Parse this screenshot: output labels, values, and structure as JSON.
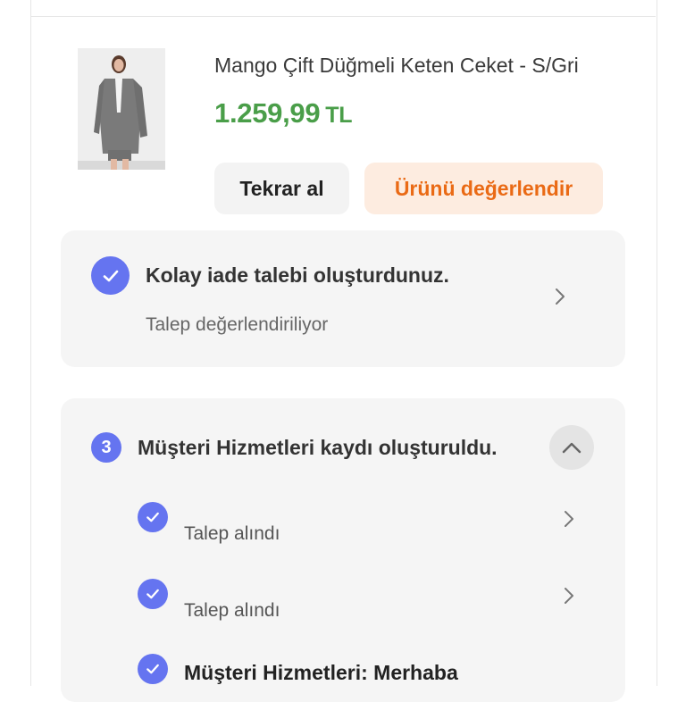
{
  "product": {
    "name": "Mango Çift Düğmeli Keten Ceket - S/Gri",
    "price": "1.259,99",
    "currency": "TL",
    "image_alt": "product-photo",
    "price_color": "#4a9e49",
    "buttons": {
      "rebuy": "Tekrar al",
      "review": "Ürünü değerlendir"
    }
  },
  "return_request": {
    "title": "Kolay iade talebi oluşturdunuz.",
    "status": "Talep değerlendiriliyor",
    "icon": "check-circle-icon"
  },
  "customer_service": {
    "step_number": "3",
    "title": "Müşteri Hizmetleri kaydı oluşturuldu.",
    "expanded": true,
    "timeline": [
      {
        "label": "Talep alındı"
      },
      {
        "label": "Talep alındı"
      },
      {
        "label": "Müşteri Hizmetleri: Merhaba"
      }
    ]
  },
  "colors": {
    "accent": "#6574f0",
    "review_text": "#ea6a15",
    "review_bg": "#fdece0",
    "card_bg": "#f5f5f5"
  }
}
